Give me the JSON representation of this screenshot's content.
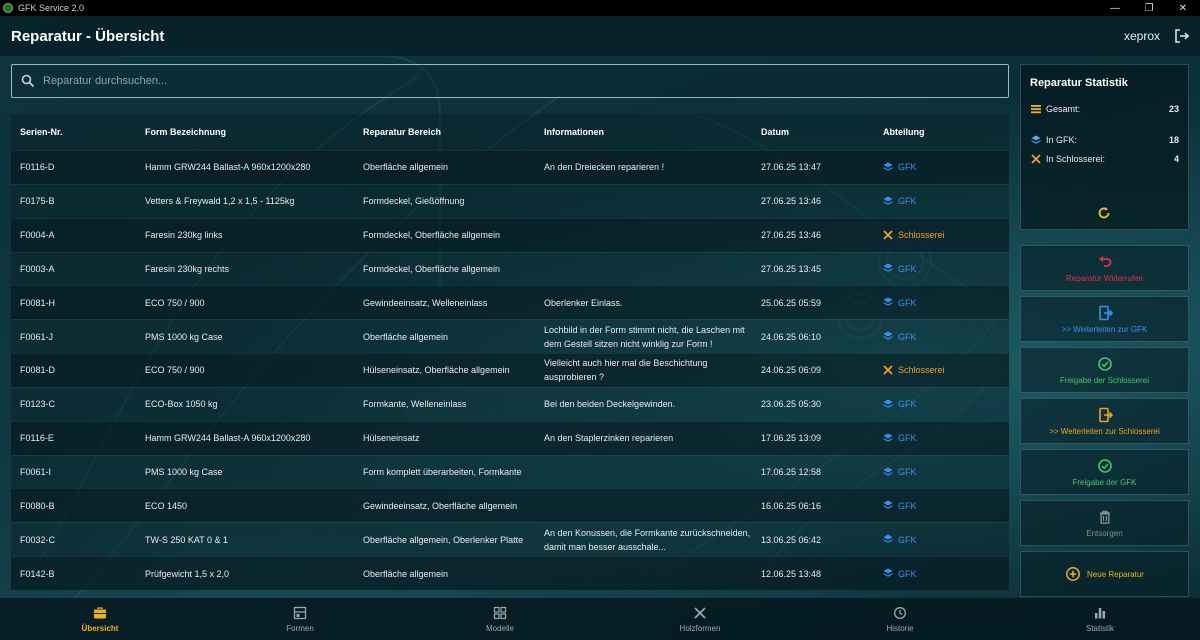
{
  "window": {
    "title": "GFK Service 2.0",
    "minimize": "—",
    "maximize": "❐",
    "close": "✕"
  },
  "header": {
    "title": "Reparatur - Übersicht",
    "user": "xeprox"
  },
  "search": {
    "placeholder": "Reparatur durchsuchen..."
  },
  "table": {
    "columns": [
      "Serien-Nr.",
      "Form Bezeichnung",
      "Reparatur Bereich",
      "Informationen",
      "Datum",
      "Abteilung"
    ],
    "rows": [
      {
        "serial": "F0116-D",
        "form": "Hamm GRW244 Ballast-A 960x1200x280",
        "area": "Oberfläche allgemein",
        "info": "An den Dreiecken reparieren !",
        "date": "27.06.25 13:47",
        "dept": "GFK"
      },
      {
        "serial": "F0175-B",
        "form": "Vetters & Freywald 1,2 x 1,5 - 1125kg",
        "area": "Formdeckel, Gießöffnung",
        "info": "",
        "date": "27.06.25 13:46",
        "dept": "GFK"
      },
      {
        "serial": "F0004-A",
        "form": "Faresin 230kg links",
        "area": "Formdeckel, Oberfläche allgemein",
        "info": "",
        "date": "27.06.25 13:46",
        "dept": "Schlosserei"
      },
      {
        "serial": "F0003-A",
        "form": "Faresin 230kg rechts",
        "area": "Formdeckel, Oberfläche allgemein",
        "info": "",
        "date": "27.06.25 13:45",
        "dept": "GFK"
      },
      {
        "serial": "F0081-H",
        "form": "ECO 750 / 900",
        "area": "Gewindeeinsatz, Welleneinlass",
        "info": "Oberlenker Einlass.",
        "date": "25.06.25 05:59",
        "dept": "GFK"
      },
      {
        "serial": "F0061-J",
        "form": "PMS 1000 kg Case",
        "area": "Oberfläche allgemein",
        "info": "Lochbild in der Form stimmt nicht, die Laschen mit dem Gestell sitzen nicht winklig zur Form !",
        "date": "24.06.25 06:10",
        "dept": "GFK"
      },
      {
        "serial": "F0081-D",
        "form": "ECO 750 / 900",
        "area": "Hülseneinsatz, Oberfläche allgemein",
        "info": "Vielleicht auch hier mal die Beschichtung ausprobieren ?",
        "date": "24.06.25 06:09",
        "dept": "Schlosserei"
      },
      {
        "serial": "F0123-C",
        "form": "ECO-Box 1050 kg",
        "area": "Formkante, Welleneinlass",
        "info": "Bei den beiden Deckelgewinden.",
        "date": "23.06.25 05:30",
        "dept": "GFK"
      },
      {
        "serial": "F0116-E",
        "form": "Hamm GRW244 Ballast-A 960x1200x280",
        "area": "Hülseneinsatz",
        "info": "An den Staplerzinken reparieren",
        "date": "17.06.25 13:09",
        "dept": "GFK"
      },
      {
        "serial": "F0061-I",
        "form": "PMS 1000 kg Case",
        "area": "Form komplett überarbeiten, Formkante",
        "info": "",
        "date": "17.06.25 12:58",
        "dept": "GFK"
      },
      {
        "serial": "F0080-B",
        "form": "ECO 1450",
        "area": "Gewindeeinsatz, Oberfläche allgemein",
        "info": "",
        "date": "16.06.25 06:16",
        "dept": "GFK"
      },
      {
        "serial": "F0032-C",
        "form": "TW-S  250 KAT 0 & 1",
        "area": "Oberfläche allgemein, Oberlenker Platte",
        "info": "An den Konussen, die Formkante zurückschneiden, damit man besser ausschale...",
        "date": "13.06.25 06:42",
        "dept": "GFK"
      },
      {
        "serial": "F0142-B",
        "form": "Prüfgewicht 1,5 x 2,0",
        "area": "Oberfläche allgemein",
        "info": "",
        "date": "12.06.25 13:48",
        "dept": "GFK"
      }
    ]
  },
  "stats": {
    "title": "Reparatur Statistik",
    "total_label": "Gesamt:",
    "total": "23",
    "gfk_label": "In GFK:",
    "gfk": "18",
    "schlosserei_label": "In Schlosserei:",
    "schlosserei": "4"
  },
  "actions": [
    {
      "label": "Reparatur Widerrufen",
      "color": "#e0304a",
      "icon": "undo-icon"
    },
    {
      "label": ">> Weiterleiten zur GFK",
      "color": "#3c8ff0",
      "icon": "forward-icon"
    },
    {
      "label": "Freigabe der Schlosserei",
      "color": "#46c46a",
      "icon": "check-circle-icon"
    },
    {
      "label": ">> Weiterleiten zur Schlosserei",
      "color": "#f0a020",
      "icon": "forward-icon"
    },
    {
      "label": "Freigabe der GFK",
      "color": "#46c46a",
      "icon": "check-circle-icon"
    },
    {
      "label": "Entsorgen",
      "color": "#7f8d91",
      "icon": "trash-icon"
    },
    {
      "label": "Neue Reparatur",
      "color": "#f0b020",
      "icon": "plus-circle-icon"
    }
  ],
  "nav": [
    {
      "label": "Übersicht",
      "icon": "toolbox-icon",
      "active": true
    },
    {
      "label": "Formen",
      "icon": "form-icon",
      "active": false
    },
    {
      "label": "Modelle",
      "icon": "models-icon",
      "active": false
    },
    {
      "label": "Holzformen",
      "icon": "tools-icon",
      "active": false
    },
    {
      "label": "Historie",
      "icon": "history-icon",
      "active": false
    },
    {
      "label": "Statistik",
      "icon": "bar-chart-icon",
      "active": false
    }
  ],
  "colors": {
    "gfk": "#3c8ff0",
    "schlosserei": "#f0a020",
    "active_nav": "#f0b020"
  }
}
